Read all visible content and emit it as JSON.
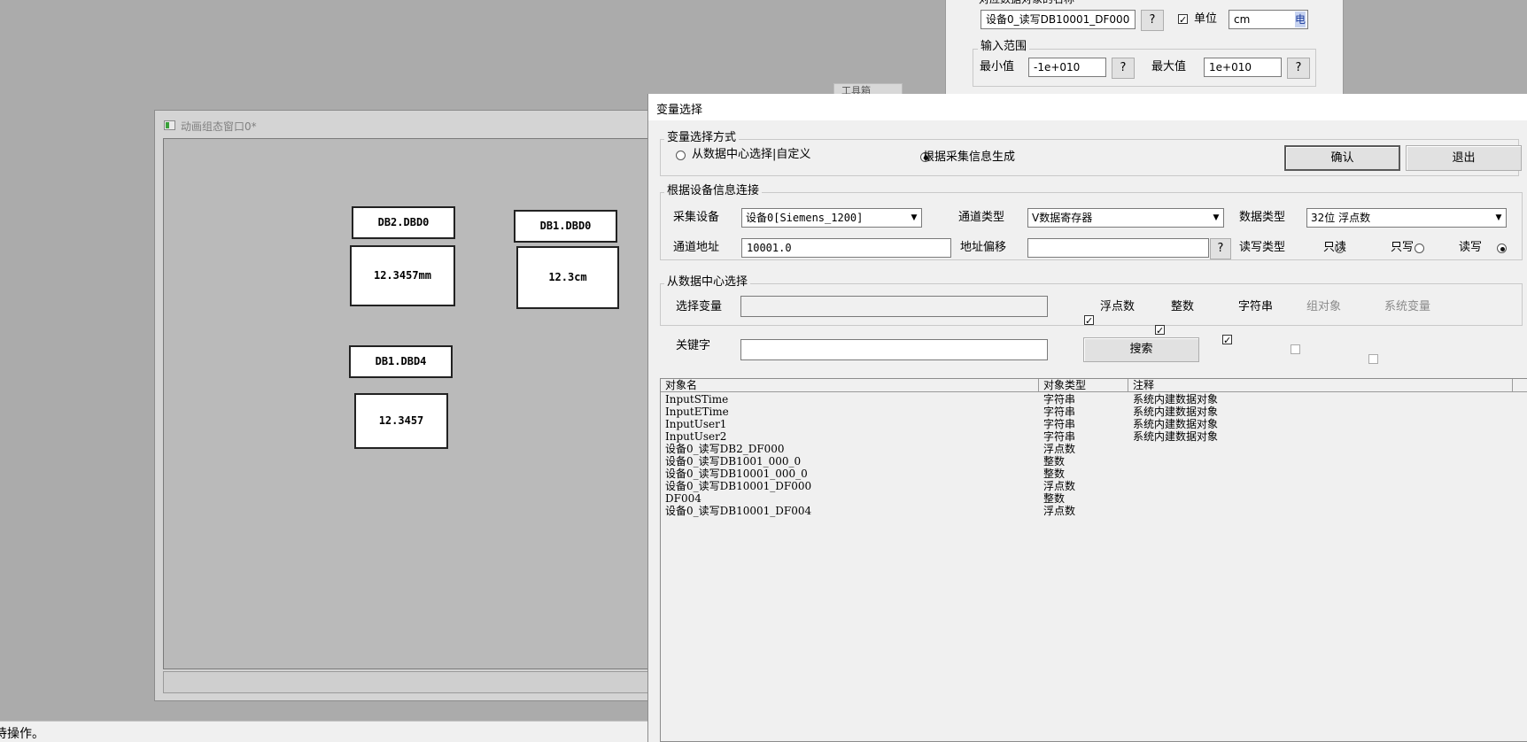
{
  "props": {
    "section_label": "对应数据对象的名称",
    "object_name": "设备0_读写DB10001_DF000",
    "unit_check_label": "单位",
    "unit_value": "cm",
    "unit_icon": "电",
    "range_group": "输入范围",
    "min_label": "最小值",
    "min_value": "-1e+010",
    "max_label": "最大值",
    "max_value": "1e+010",
    "help": "?"
  },
  "toolbox_tab": "工具箱",
  "anim_window": {
    "title": "动画组态窗口0*",
    "labels": [
      {
        "text": "DB2.DBD0"
      },
      {
        "text": "DB1.DBD0"
      },
      {
        "text": "DB1.DBD4"
      }
    ],
    "values": [
      {
        "text": "12.3457mm"
      },
      {
        "text": "12.3cm"
      },
      {
        "text": "12.3457"
      }
    ]
  },
  "status_text": "待操作。",
  "dialog": {
    "title": "变量选择",
    "mode_group": "变量选择方式",
    "mode_datacenter": "从数据中心选择|自定义",
    "mode_collect": "根据采集信息生成",
    "confirm": "确认",
    "exit": "退出",
    "device_group": "根据设备信息连接",
    "device_label": "采集设备",
    "device_value": "设备0[Siemens_1200]",
    "channel_type_label": "通道类型",
    "channel_type_value": "V数据寄存器",
    "data_type_label": "数据类型",
    "data_type_value": "32位 浮点数",
    "address_label": "通道地址",
    "address_value": "10001.0",
    "offset_label": "地址偏移",
    "offset_value": "",
    "help": "?",
    "rw_label": "读写类型",
    "rw_read": "只读",
    "rw_write": "只写",
    "rw_readwrite": "读写",
    "dc_group": "从数据中心选择",
    "select_var_label": "选择变量",
    "filter_float": "浮点数",
    "filter_int": "整数",
    "filter_string": "字符串",
    "filter_group": "组对象",
    "filter_system": "系统变量",
    "keyword_label": "关键字",
    "search_button": "搜索",
    "columns": [
      "对象名",
      "对象类型",
      "注释"
    ],
    "rows": [
      {
        "name": "InputSTime",
        "type": "字符串",
        "note": "系统内建数据对象"
      },
      {
        "name": "InputETime",
        "type": "字符串",
        "note": "系统内建数据对象"
      },
      {
        "name": "InputUser1",
        "type": "字符串",
        "note": "系统内建数据对象"
      },
      {
        "name": "InputUser2",
        "type": "字符串",
        "note": "系统内建数据对象"
      },
      {
        "name": "设备0_读写DB2_DF000",
        "type": "浮点数",
        "note": ""
      },
      {
        "name": "设备0_读写DB1001_000_0",
        "type": "整数",
        "note": ""
      },
      {
        "name": "设备0_读写DB10001_000_0",
        "type": "整数",
        "note": ""
      },
      {
        "name": "设备0_读写DB10001_DF000",
        "type": "浮点数",
        "note": ""
      },
      {
        "name": "DF004",
        "type": "整数",
        "note": ""
      },
      {
        "name": "设备0_读写DB10001_DF004",
        "type": "浮点数",
        "note": ""
      }
    ]
  }
}
